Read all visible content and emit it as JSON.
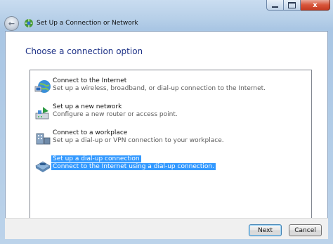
{
  "window": {
    "title": "Set Up a Connection or Network",
    "close_glyph": "x"
  },
  "page": {
    "heading": "Choose a connection option"
  },
  "options": [
    {
      "title": "Connect to the Internet",
      "desc": "Set up a wireless, broadband, or dial-up connection to the Internet.",
      "icon": "globe-network-icon",
      "selected": false
    },
    {
      "title": "Set up a new network",
      "desc": "Configure a new router or access point.",
      "icon": "router-icon",
      "selected": false
    },
    {
      "title": "Connect to a workplace",
      "desc": "Set up a dial-up or VPN connection to your workplace.",
      "icon": "workplace-icon",
      "selected": false
    },
    {
      "title": "Set up a dial-up connection",
      "desc": "Connect to the Internet using a dial-up connection.",
      "icon": "phone-modem-icon",
      "selected": true
    }
  ],
  "buttons": {
    "next": "Next",
    "cancel": "Cancel"
  },
  "colors": {
    "heading": "#1e3287",
    "selection": "#3399ff",
    "close_button": "#c43b22"
  }
}
